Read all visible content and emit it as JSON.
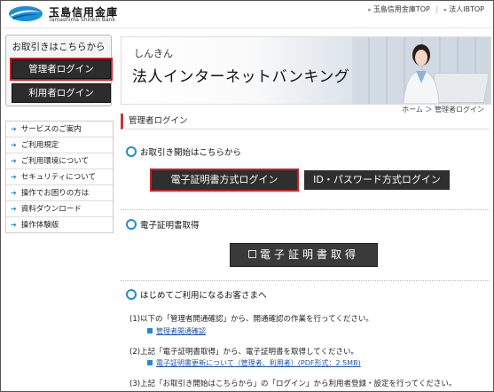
{
  "header": {
    "brand_jp": "玉島信用金庫",
    "brand_en": "Tamashima Shinkin Bank",
    "links": [
      "玉島信用金庫TOP",
      "法人IBTOP"
    ]
  },
  "sidebar": {
    "login_title": "お取引きはこちらから",
    "admin_login": "管理者ログイン",
    "user_login": "利用者ログイン",
    "menu": [
      "サービスのご案内",
      "ご利用規定",
      "ご利用環境について",
      "セキュリティについて",
      "操作でお困りの方は",
      "資料ダウンロード",
      "操作体験版"
    ]
  },
  "banner": {
    "subtitle": "しんきん",
    "title": "法人インターネットバンキング"
  },
  "breadcrumb": "ホーム ＞ 管理者ログイン",
  "main": {
    "page_title": "管理者ログイン",
    "section1": "お取引き開始はこちらから",
    "cert_login": "電子証明書方式ログイン",
    "idpw_login": "ID・パスワード方式ログイン",
    "section2": "電子証明書取得",
    "cert_get": "電子証明書取得",
    "section3": "はじめてご利用になるお客さまへ",
    "step1": "(1)以下の「管理者開通確認」から、開通確認の作業を行ってください。",
    "link1": "管理者開通確認",
    "step2": "(2)上記「電子証明書取得」から、電子証明書を取得してください。",
    "link2": "電子証明書更新について（管理者、利用者）(PDF形式：2.5MB)",
    "step3": "(3)上記「お取引き開始はこちらから」の「ログイン」から利用者登録・設定を行ってください。"
  }
}
